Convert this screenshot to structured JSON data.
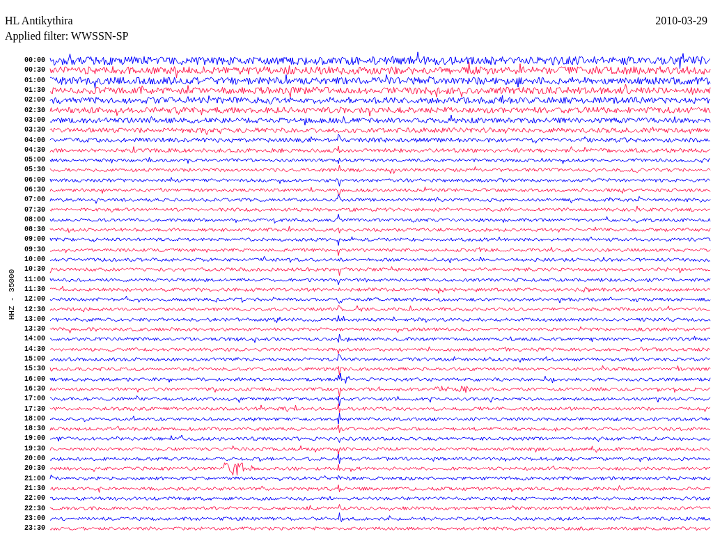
{
  "header": {
    "station": "HL Antikythira",
    "date": "2010-03-29",
    "filter": "Applied filter: WWSSN-SP"
  },
  "axis_label": "HHZ - 35000",
  "rows": [
    {
      "time": "00:00",
      "color": "#0000ff"
    },
    {
      "time": "00:30",
      "color": "#ff1a4f"
    },
    {
      "time": "01:00",
      "color": "#0000ff"
    },
    {
      "time": "01:30",
      "color": "#ff1a4f"
    },
    {
      "time": "02:00",
      "color": "#0000ff"
    },
    {
      "time": "02:30",
      "color": "#ff1a4f"
    },
    {
      "time": "03:00",
      "color": "#0000ff"
    },
    {
      "time": "03:30",
      "color": "#ff1a4f"
    },
    {
      "time": "04:00",
      "color": "#0000ff"
    },
    {
      "time": "04:30",
      "color": "#ff1a4f"
    },
    {
      "time": "05:00",
      "color": "#0000ff"
    },
    {
      "time": "05:30",
      "color": "#ff1a4f"
    },
    {
      "time": "06:00",
      "color": "#0000ff"
    },
    {
      "time": "06:30",
      "color": "#ff1a4f"
    },
    {
      "time": "07:00",
      "color": "#0000ff"
    },
    {
      "time": "07:30",
      "color": "#ff1a4f"
    },
    {
      "time": "08:00",
      "color": "#0000ff"
    },
    {
      "time": "08:30",
      "color": "#ff1a4f"
    },
    {
      "time": "09:00",
      "color": "#0000ff"
    },
    {
      "time": "09:30",
      "color": "#ff1a4f"
    },
    {
      "time": "10:00",
      "color": "#0000ff"
    },
    {
      "time": "10:30",
      "color": "#ff1a4f"
    },
    {
      "time": "11:00",
      "color": "#0000ff"
    },
    {
      "time": "11:30",
      "color": "#ff1a4f"
    },
    {
      "time": "12:00",
      "color": "#0000ff"
    },
    {
      "time": "12:30",
      "color": "#ff1a4f"
    },
    {
      "time": "13:00",
      "color": "#0000ff"
    },
    {
      "time": "13:30",
      "color": "#ff1a4f"
    },
    {
      "time": "14:00",
      "color": "#0000ff"
    },
    {
      "time": "14:30",
      "color": "#ff1a4f"
    },
    {
      "time": "15:00",
      "color": "#0000ff"
    },
    {
      "time": "15:30",
      "color": "#ff1a4f"
    },
    {
      "time": "16:00",
      "color": "#0000ff"
    },
    {
      "time": "16:30",
      "color": "#ff1a4f"
    },
    {
      "time": "17:00",
      "color": "#0000ff"
    },
    {
      "time": "17:30",
      "color": "#ff1a4f"
    },
    {
      "time": "18:00",
      "color": "#0000ff"
    },
    {
      "time": "18:30",
      "color": "#ff1a4f"
    },
    {
      "time": "19:00",
      "color": "#0000ff"
    },
    {
      "time": "19:30",
      "color": "#ff1a4f"
    },
    {
      "time": "20:00",
      "color": "#0000ff"
    },
    {
      "time": "20:30",
      "color": "#ff1a4f"
    },
    {
      "time": "21:00",
      "color": "#0000ff"
    },
    {
      "time": "21:30",
      "color": "#ff1a4f"
    },
    {
      "time": "22:00",
      "color": "#0000ff"
    },
    {
      "time": "22:30",
      "color": "#ff1a4f"
    },
    {
      "time": "23:00",
      "color": "#0000ff"
    },
    {
      "time": "23:30",
      "color": "#ff1a4f"
    }
  ]
}
